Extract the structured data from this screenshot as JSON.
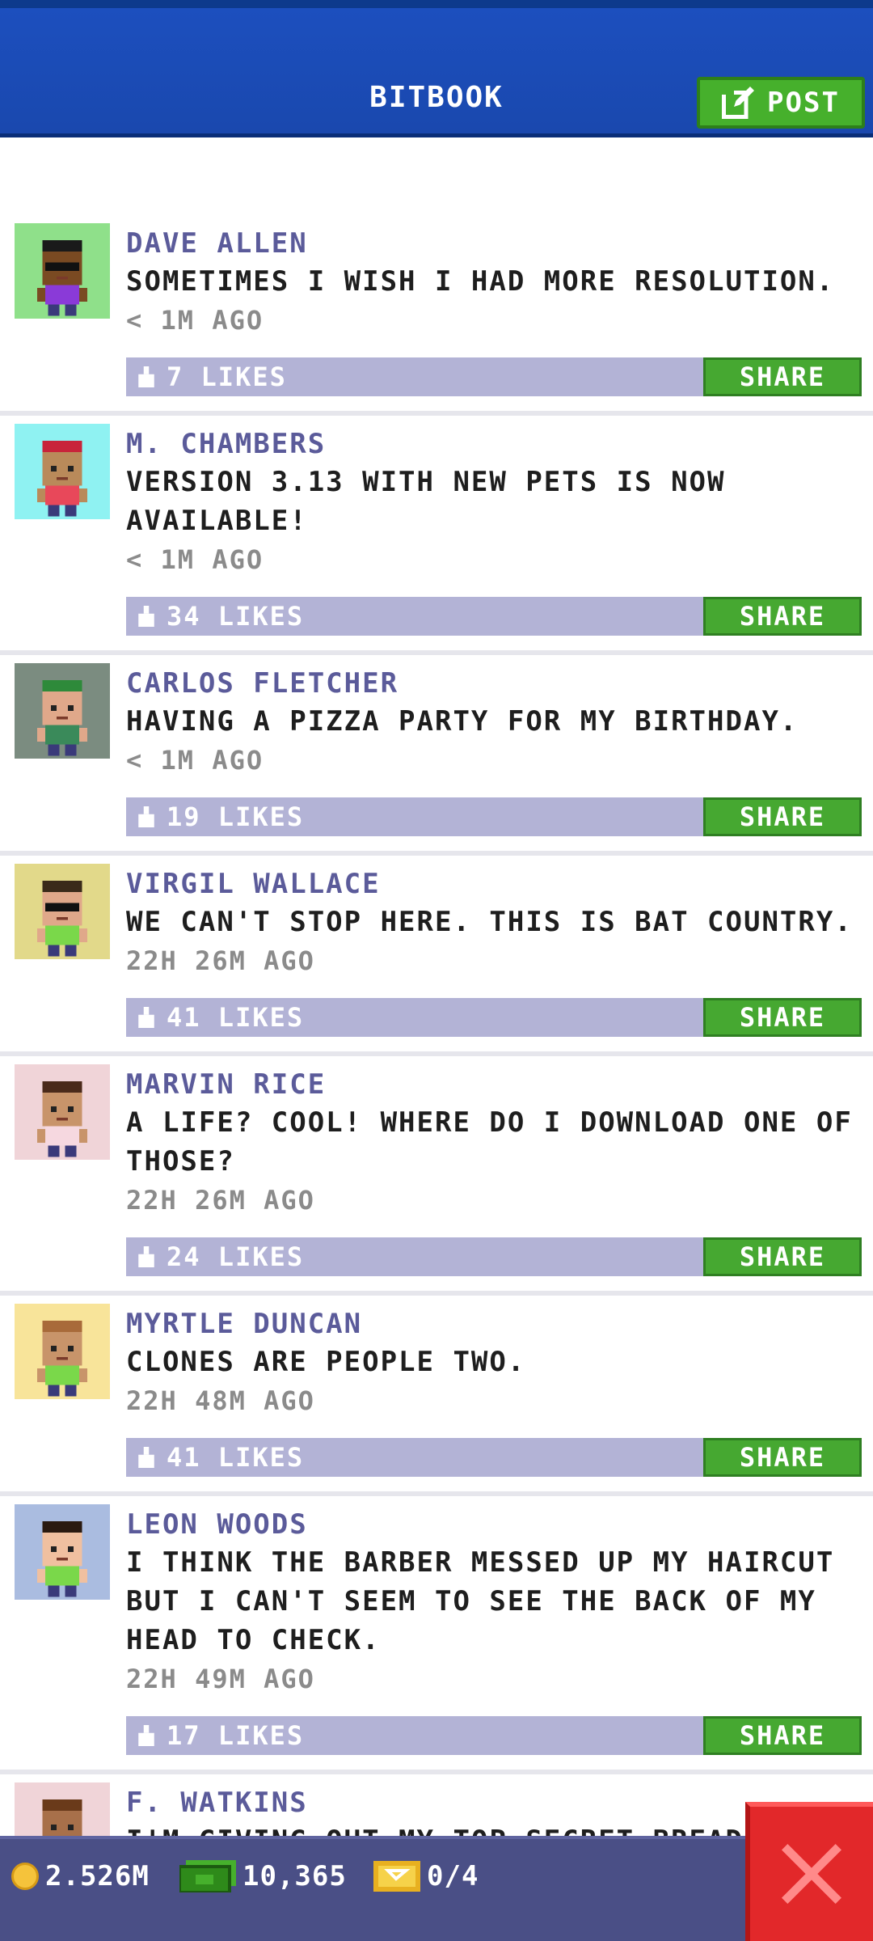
{
  "header": {
    "title": "BITBOOK",
    "post_label": "POST"
  },
  "colors": {
    "header_blue": "#1c4fbe",
    "author_purple": "#5b5b9a",
    "likes_bar": "#b3b3d6",
    "share_green": "#46a831",
    "status_bar": "#4a4f86",
    "close_red": "#e2282a"
  },
  "posts": [
    {
      "author": "DAVE ALLEN",
      "text": "SOMETIMES I WISH I HAD MORE RESOLUTION.",
      "time": "< 1M AGO",
      "likes": "7 LIKES",
      "share": "SHARE",
      "avatar_bg": "#8fe08a",
      "skin": "#7a4a22",
      "shirt": "#8a3ad8",
      "hair": "#1a1a1a",
      "shades": true
    },
    {
      "author": "M. CHAMBERS",
      "text": "VERSION 3.13 WITH NEW PETS IS NOW AVAILABLE!",
      "time": "< 1M AGO",
      "likes": "34 LIKES",
      "share": "SHARE",
      "avatar_bg": "#8ff2f2",
      "skin": "#b98a5a",
      "shirt": "#e8485a",
      "hair": "#c8243a",
      "shades": false
    },
    {
      "author": "CARLOS FLETCHER",
      "text": "HAVING A PIZZA PARTY FOR MY BIRTHDAY.",
      "time": "< 1M AGO",
      "likes": "19 LIKES",
      "share": "SHARE",
      "avatar_bg": "#7b8c80",
      "skin": "#e0a88a",
      "shirt": "#3a8a5a",
      "hair": "#2e8a3a",
      "shades": false
    },
    {
      "author": "VIRGIL WALLACE",
      "text": "WE CAN'T STOP HERE. THIS IS BAT COUNTRY.",
      "time": "22H 26M AGO",
      "likes": "41 LIKES",
      "share": "SHARE",
      "avatar_bg": "#e2d98a",
      "skin": "#e0a88a",
      "shirt": "#7ad84a",
      "hair": "#3a2a1a",
      "shades": true
    },
    {
      "author": "MARVIN RICE",
      "text": "A LIFE? COOL! WHERE DO I DOWNLOAD ONE OF THOSE?",
      "time": "22H 26M AGO",
      "likes": "24 LIKES",
      "share": "SHARE",
      "avatar_bg": "#f0d4d8",
      "skin": "#c8946a",
      "shirt": "#f6d8e0",
      "hair": "#4a2a1a",
      "shades": false
    },
    {
      "author": "MYRTLE DUNCAN",
      "text": "CLONES ARE PEOPLE TWO.",
      "time": "22H 48M AGO",
      "likes": "41 LIKES",
      "share": "SHARE",
      "avatar_bg": "#f8e49a",
      "skin": "#c8946a",
      "shirt": "#7ad84a",
      "hair": "#a86a3a",
      "shades": false
    },
    {
      "author": "LEON WOODS",
      "text": "I THINK THE BARBER MESSED UP MY HAIRCUT BUT I CAN'T SEEM TO SEE THE BACK OF MY HEAD TO CHECK.",
      "time": "22H 49M AGO",
      "likes": "17 LIKES",
      "share": "SHARE",
      "avatar_bg": "#aabce0",
      "skin": "#f0c0a0",
      "shirt": "#7ad84a",
      "hair": "#2a1a10",
      "shades": false
    },
    {
      "author": "F. WATKINS",
      "text": "I'M GIVING OUT MY TOP SECRET BREAD",
      "time": "",
      "likes": "",
      "share": "",
      "avatar_bg": "#f0d4d8",
      "skin": "#a8704a",
      "shirt": "#c89a3a",
      "hair": "#6a3a1a",
      "shades": false
    }
  ],
  "status": {
    "coins": "2.526M",
    "bux": "10,365",
    "tickets": "0/4"
  }
}
